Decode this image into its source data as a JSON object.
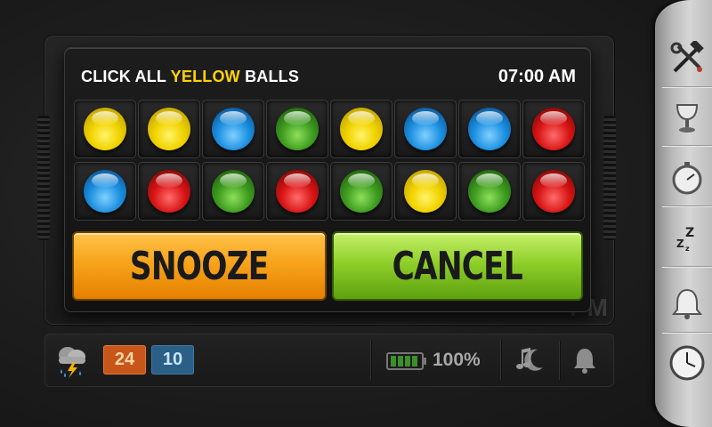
{
  "dialog": {
    "instruction_prefix": "CLICK ALL ",
    "instruction_highlight": "YELLOW",
    "instruction_suffix": " BALLS",
    "time": "07:00 AM",
    "target_color": "yellow",
    "balls": [
      [
        "yellow",
        "yellow",
        "blue",
        "green",
        "yellow",
        "blue",
        "blue",
        "red"
      ],
      [
        "blue",
        "red",
        "green",
        "red",
        "green",
        "yellow",
        "green",
        "red"
      ]
    ],
    "snooze_label": "SNOOZE",
    "cancel_label": "CANCEL"
  },
  "background": {
    "pm_label": "PM"
  },
  "statusbar": {
    "weather_icon": "storm-cloud-icon",
    "temp_high": "24",
    "temp_low": "10",
    "battery_icon": "battery-icon",
    "battery_percent": "100%",
    "music_icon": "music-moon-icon",
    "alarm_icon": "bell-icon"
  },
  "sidebar": {
    "items": [
      {
        "icon": "tools-icon",
        "label": "settings"
      },
      {
        "icon": "goblet-icon",
        "label": "night"
      },
      {
        "icon": "stopwatch-icon",
        "label": "timer"
      },
      {
        "icon": "sleep-zzz-icon",
        "label": "sleep"
      },
      {
        "icon": "bell-icon",
        "label": "alarms"
      },
      {
        "icon": "clock-icon",
        "label": "clock"
      }
    ]
  },
  "colors": {
    "highlight": "#ffd400",
    "snooze": "#f7a41b",
    "cancel": "#8fcf2a",
    "temp_high_bg": "#c8561a",
    "temp_low_bg": "#2b5f86"
  }
}
